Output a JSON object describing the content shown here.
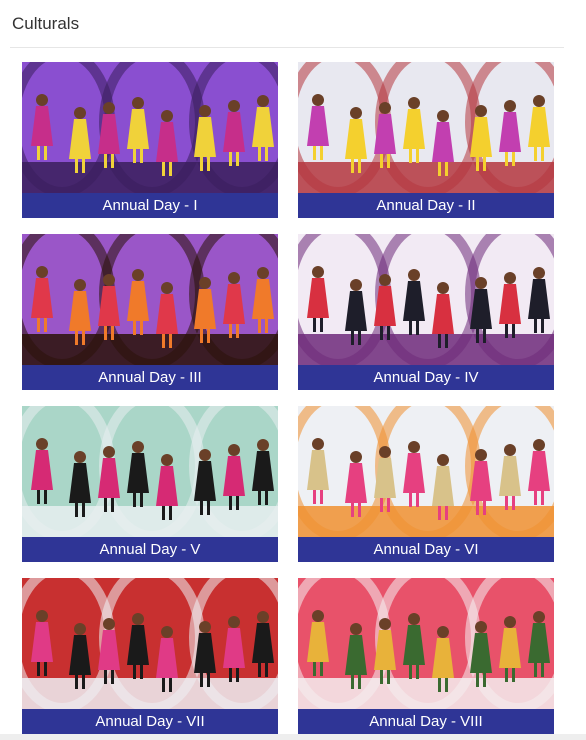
{
  "section": {
    "title": "Culturals"
  },
  "colors": {
    "caption_bg": "#2f3596",
    "caption_text": "#ffffff",
    "title_text": "#333333"
  },
  "gallery": {
    "items": [
      {
        "caption": "Annual Day - I",
        "photo_icon": "group-dance-photo",
        "palette": [
          "#3a1f5c",
          "#c62e8a",
          "#f0d23a",
          "#8a4fd0"
        ]
      },
      {
        "caption": "Annual Day - II",
        "photo_icon": "group-dance-photo",
        "palette": [
          "#b4363e",
          "#c23fb0",
          "#f4d02e",
          "#e8e8f0"
        ]
      },
      {
        "caption": "Annual Day - III",
        "photo_icon": "group-dance-photo",
        "palette": [
          "#2a1208",
          "#e0384a",
          "#f07a2a",
          "#9a56c8"
        ]
      },
      {
        "caption": "Annual Day - IV",
        "photo_icon": "group-dance-photo",
        "palette": [
          "#6e2a7a",
          "#d83040",
          "#1e1e2a",
          "#f2eaf4"
        ]
      },
      {
        "caption": "Annual Day - V",
        "photo_icon": "group-dance-photo",
        "palette": [
          "#e8eef0",
          "#d62a74",
          "#1a1a1a",
          "#aad6c8"
        ]
      },
      {
        "caption": "Annual Day - VI",
        "photo_icon": "group-dance-photo",
        "palette": [
          "#f09030",
          "#d8c28a",
          "#e64080",
          "#eef0f4"
        ]
      },
      {
        "caption": "Annual Day - VII",
        "photo_icon": "group-dance-photo",
        "palette": [
          "#eef0f4",
          "#e03a86",
          "#1a1a1a",
          "#c83030"
        ]
      },
      {
        "caption": "Annual Day - VIII",
        "photo_icon": "group-dance-photo",
        "palette": [
          "#f4eef0",
          "#e8b23a",
          "#3a6a30",
          "#e8526a"
        ]
      }
    ]
  }
}
